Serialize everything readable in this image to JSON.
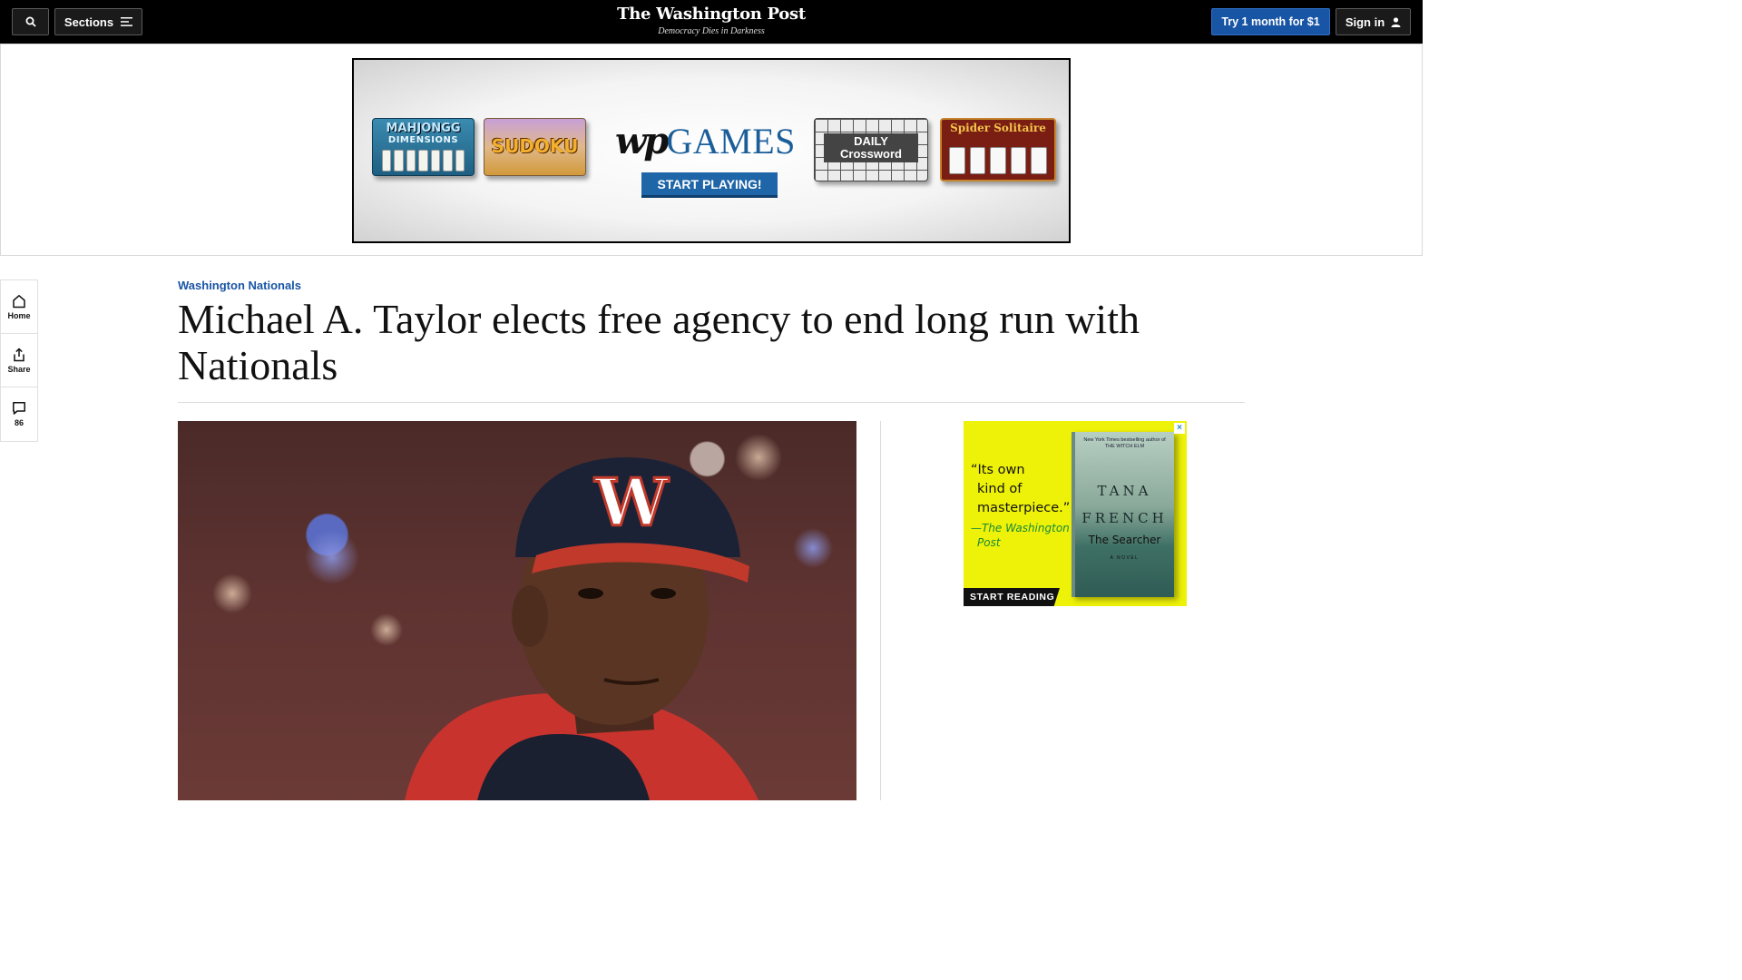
{
  "header": {
    "sections_label": "Sections",
    "logo_text": "The Washington Post",
    "tagline": "Democracy Dies in Darkness",
    "subscribe_label": "Try 1 month for $1",
    "signin_label": "Sign in"
  },
  "top_ad": {
    "tiles": {
      "mahjongg_title": "MAHJONGG",
      "mahjongg_sub": "DIMENSIONS",
      "sudoku": "SUDOKU",
      "wp": "wp",
      "games": "GAMES",
      "start": "START PLAYING!",
      "crossword": "DAILY Crossword",
      "spider": "Spider Solitaire"
    }
  },
  "rail": {
    "home_label": "Home",
    "share_label": "Share",
    "comments_count": "86"
  },
  "article": {
    "kicker": "Washington Nationals",
    "headline": "Michael A. Taylor elects free agency to end long run with Nationals"
  },
  "side_ad": {
    "quote_line1": "“Its own",
    "quote_line2": "kind of",
    "quote_line3": "masterpiece.”",
    "attrib_line1": "—The Washington",
    "attrib_line2": "Post",
    "cta": "START READING",
    "close": "×",
    "book_blurb": "New York Times bestselling author of THE WITCH ELM",
    "book_author_first": "TANA",
    "book_author_last": "FRENCH",
    "book_title": "The Searcher",
    "book_novel": "A NOVEL"
  },
  "colors": {
    "brand_blue": "#1955a5",
    "topbar": "#000000",
    "ad_yellow": "#eef208"
  },
  "icons": [
    "search-icon",
    "menu-icon",
    "user-icon",
    "home-icon",
    "share-icon",
    "comment-icon"
  ]
}
